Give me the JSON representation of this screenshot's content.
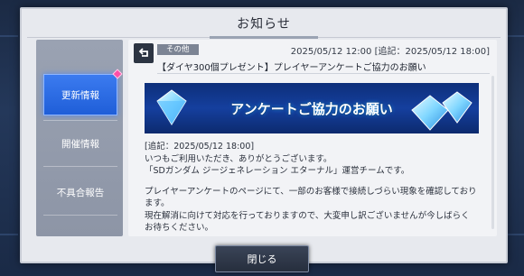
{
  "dialog": {
    "title": "お知らせ"
  },
  "sidebar": {
    "items": [
      {
        "label": "更新情報",
        "active": true,
        "has_badge": true
      },
      {
        "label": "開催情報",
        "active": false,
        "has_badge": false
      },
      {
        "label": "不具合報告",
        "active": false,
        "has_badge": false
      }
    ]
  },
  "notice": {
    "category": "その他",
    "date": "2025/05/12 12:00 [追記：2025/05/12 18:00]",
    "headline": "【ダイヤ300個プレゼント】プレイヤーアンケートご協力のお願い",
    "banner_text": "アンケートご協力のお願い",
    "body": {
      "line1": "[追記：2025/05/12 18:00]",
      "line2": "いつもご利用いただき、ありがとうございます。",
      "line3": "「SDガンダム ジージェネレーション エターナル」運営チームです。",
      "line4": "プレイヤーアンケートのページにて、一部のお客様で接続しづらい現象を確認しており",
      "line5": "ます。",
      "line6": "現在解消に向けて対応を行っておりますので、大変申し訳ございませんが今しばらく",
      "line7": "お待ちください。"
    }
  },
  "footer": {
    "close_label": "閉じる"
  },
  "icons": {
    "back": "return-arrow-icon",
    "gem": "diamond-icon"
  },
  "colors": {
    "accent": "#2a6cf0",
    "badge": "#ff4fa8",
    "banner": "#153f9e"
  }
}
